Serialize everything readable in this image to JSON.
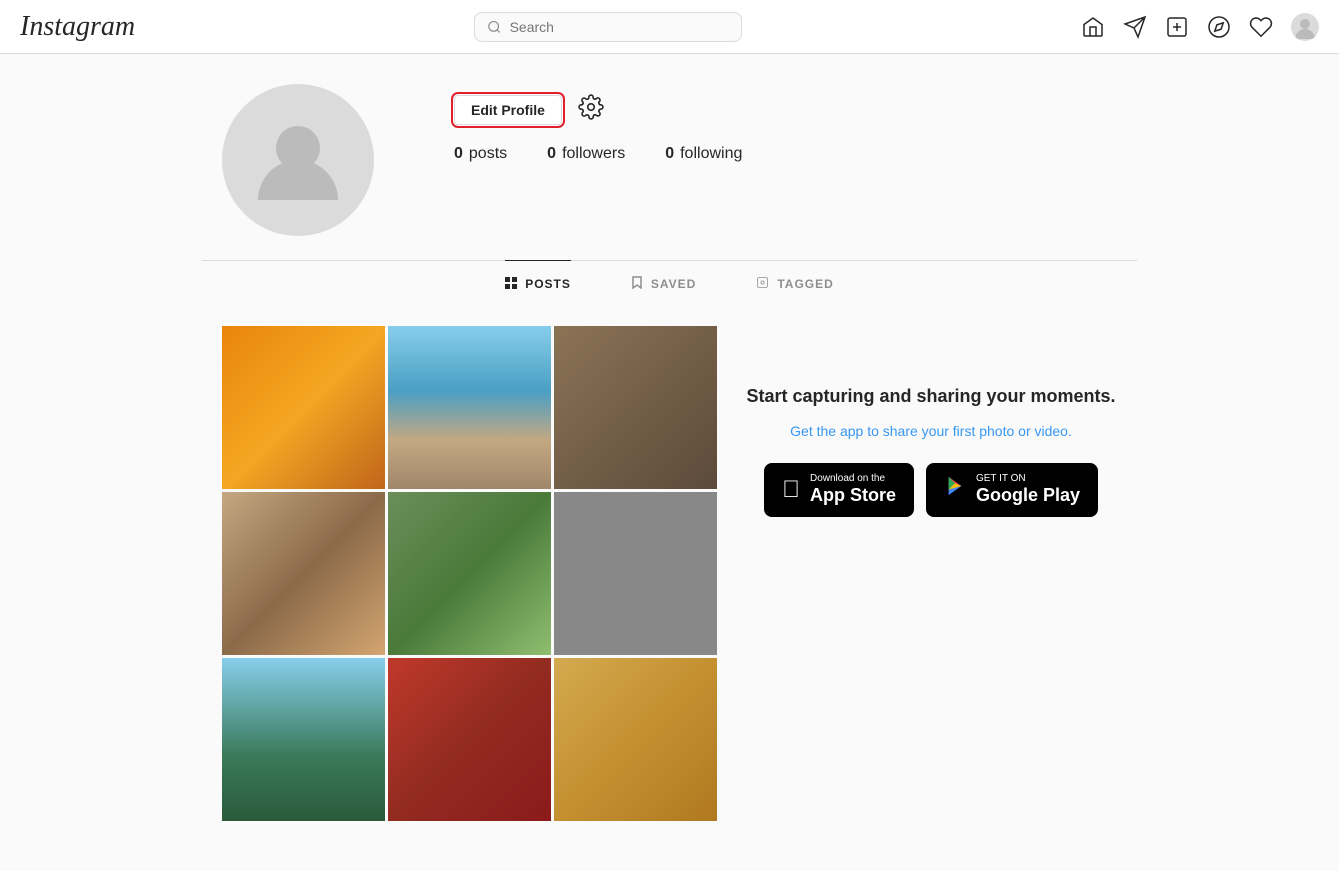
{
  "header": {
    "logo": "Instagram",
    "search": {
      "placeholder": "Search",
      "value": ""
    },
    "icons": [
      "home",
      "send",
      "new-post",
      "explore",
      "heart",
      "profile"
    ]
  },
  "profile": {
    "stats": {
      "posts": {
        "count": "0",
        "label": "posts"
      },
      "followers": {
        "count": "0",
        "label": "followers"
      },
      "following": {
        "count": "0",
        "label": "following"
      }
    },
    "edit_profile_label": "Edit Profile"
  },
  "tabs": [
    {
      "id": "posts",
      "label": "POSTS",
      "active": true
    },
    {
      "id": "saved",
      "label": "SAVED",
      "active": false
    },
    {
      "id": "tagged",
      "label": "TAGGED",
      "active": false
    }
  ],
  "cta": {
    "title": "Start capturing and sharing your moments.",
    "subtitle": "Get the app to share your first photo or video."
  },
  "app_store": {
    "small": "Download on the",
    "large": "App Store"
  },
  "google_play": {
    "small": "GET IT ON",
    "large": "Google Play"
  }
}
